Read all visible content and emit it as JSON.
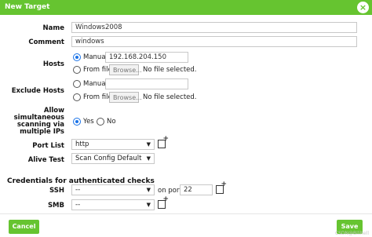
{
  "dialog": {
    "title": "New Target",
    "close_glyph": "×"
  },
  "fields": {
    "name_label": "Name",
    "name_value": "Windows2008",
    "comment_label": "Comment",
    "comment_value": "windows",
    "hosts_label": "Hosts",
    "hosts_manual_label": "Manual",
    "hosts_manual_value": "192.168.204.150",
    "hosts_fromfile_label": "From file",
    "hosts_browse_label": "Browse...",
    "hosts_nofile_text": "No file selected.",
    "exclude_label": "Exclude Hosts",
    "exclude_manual_label": "Manual",
    "exclude_manual_value": "",
    "exclude_fromfile_label": "From file",
    "exclude_browse_label": "Browse...",
    "exclude_nofile_text": "No file selected.",
    "simultaneous_label_1": "Allow",
    "simultaneous_label_2": "simultaneous",
    "simultaneous_label_3": "scanning via",
    "simultaneous_label_4": "multiple IPs",
    "yes_label": "Yes",
    "no_label": "No",
    "portlist_label": "Port List",
    "portlist_value": "http",
    "alivetest_label": "Alive Test",
    "alivetest_value": "Scan Config Default"
  },
  "credentials": {
    "section_title": "Credentials for authenticated checks",
    "ssh_label": "SSH",
    "ssh_value": "--",
    "ssh_port_label": "on port",
    "ssh_port_value": "22",
    "smb_label": "SMB",
    "smb_value": "--"
  },
  "footer": {
    "cancel_label": "Cancel",
    "save_label": "Save",
    "watermark": "CSDN@Bilihell"
  },
  "icons": {
    "dropdown": "▼",
    "new": "new-item-icon"
  },
  "colors": {
    "accent": "#66c430",
    "radio": "#1a73e8"
  }
}
